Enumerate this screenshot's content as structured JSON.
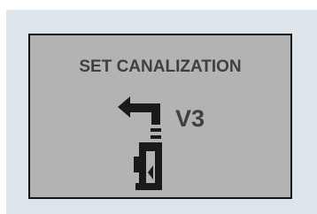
{
  "set_canalization_button": {
    "title": "SET CANALIZATION",
    "valve": "V3",
    "icon": "canalization-valve-icon",
    "colors": {
      "panel_background": "#dde4ea",
      "button_background": "#b3b3b3",
      "button_border": "#151515",
      "text": "#3f3f3f",
      "icon": "#1a1a1a"
    }
  }
}
